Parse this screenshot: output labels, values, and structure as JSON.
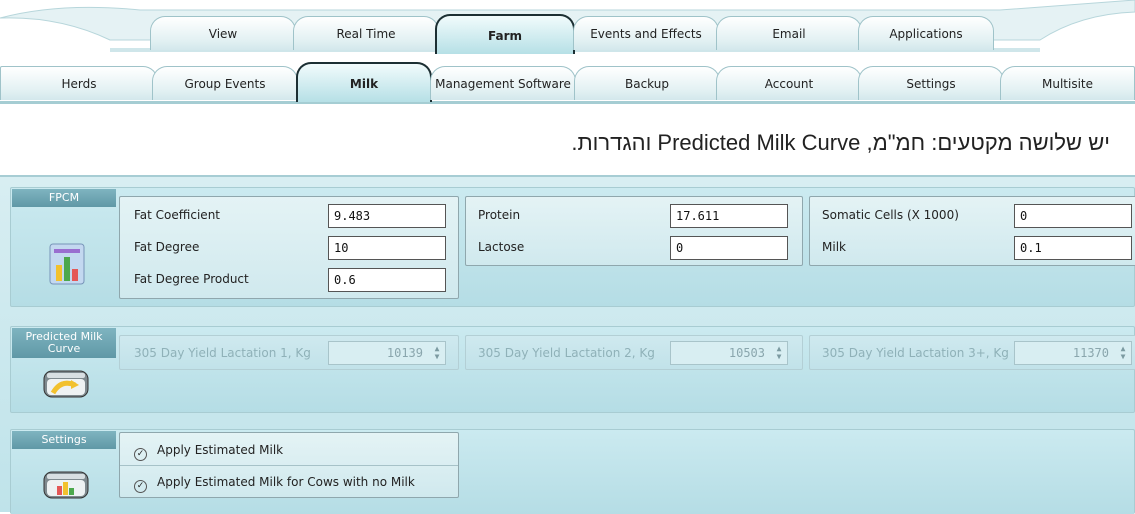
{
  "top_tabs": [
    "View",
    "Real Time",
    "Farm",
    "Events and Effects",
    "Email",
    "Applications"
  ],
  "top_active": "Farm",
  "sub_tabs": [
    "Herds",
    "Group Events",
    "Milk",
    "Management Software",
    "Backup",
    "Account",
    "Settings",
    "Multisite"
  ],
  "sub_active": "Milk",
  "caption": "יש שלושה מקטעים: חמ\"מ, Predicted Milk Curve והגדרות.",
  "fpcm": {
    "title": "FPCM",
    "icon": "bar-chart-icon",
    "fat_coefficient_label": "Fat Coefficient",
    "fat_coefficient_value": "9.483",
    "fat_degree_label": "Fat Degree",
    "fat_degree_value": "10",
    "fat_degree_product_label": "Fat Degree Product",
    "fat_degree_product_value": "0.6",
    "protein_label": "Protein",
    "protein_value": "17.611",
    "lactose_label": "Lactose",
    "lactose_value": "0",
    "somatic_label": "Somatic Cells (X 1000)",
    "somatic_value": "0",
    "milk_label": "Milk",
    "milk_value": "0.1"
  },
  "predicted": {
    "title": "Predicted Milk Curve",
    "icon": "milk-tank-curve-icon",
    "lact1_label": "305 Day Yield Lactation 1, Kg",
    "lact1_value": "10139",
    "lact2_label": "305 Day Yield Lactation 2, Kg",
    "lact2_value": "10503",
    "lact3_label": "305 Day Yield Lactation 3+, Kg",
    "lact3_value": "11370"
  },
  "settings": {
    "title": "Settings",
    "icon": "milk-tank-chart-icon",
    "opt1": "Apply Estimated Milk",
    "opt2": "Apply Estimated Milk for Cows with no Milk"
  },
  "colors": {
    "accent": "#5f98a6",
    "panel": "#c8e7ed",
    "active_tab_border": "#1c2f33"
  }
}
